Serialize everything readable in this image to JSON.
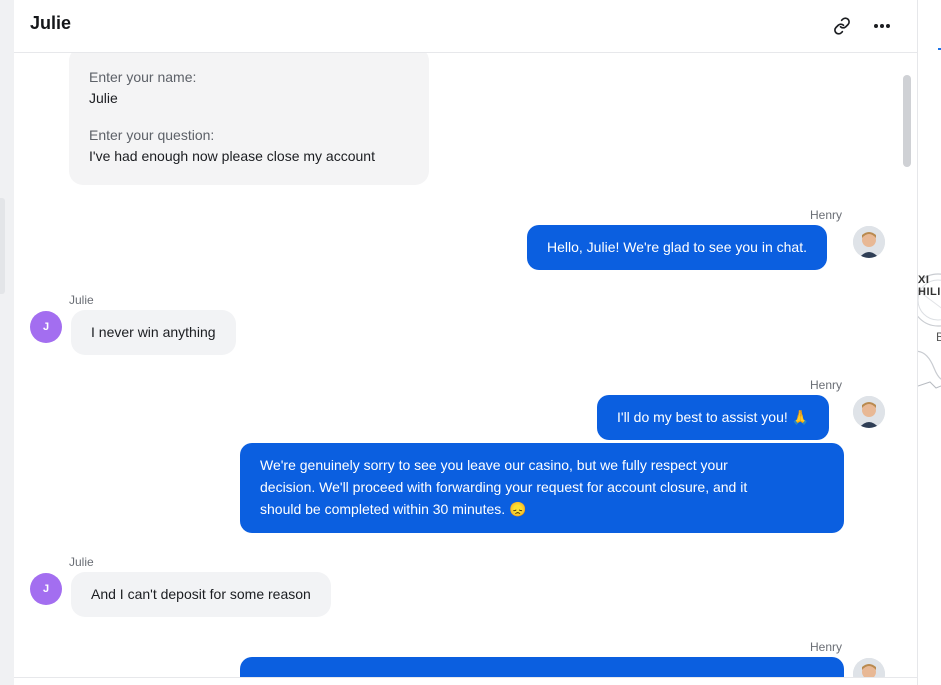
{
  "header": {
    "title": "Julie",
    "link_icon": "link-icon",
    "more_icon": "more-horizontal-icon"
  },
  "form": {
    "name_label": "Enter your name:",
    "name_value": "Julie",
    "question_label": "Enter your question:",
    "question_value": "I've had enough now please close my account"
  },
  "messages": [
    {
      "sender": "Henry",
      "text": "Hello, Julie! We're glad to see you in chat."
    },
    {
      "sender": "Julie",
      "avatar_letter": "J",
      "text": "I never win anything"
    },
    {
      "sender": "Henry",
      "text": "I'll do my best to assist you! 🙏"
    },
    {
      "text_lines": [
        "We're genuinely sorry to see you leave our casino, but we fully respect your",
        "decision. We'll proceed with forwarding your request for account closure, and it",
        "should be completed within 30 minutes. 😞"
      ]
    },
    {
      "sender": "Julie",
      "avatar_letter": "J",
      "text": "And I can't deposit for some reason"
    },
    {
      "sender": "Henry"
    }
  ],
  "side_map": {
    "label_1": "XI",
    "label_2": "HILI",
    "label_3": "B"
  },
  "colors": {
    "accent": "#0b5fe0",
    "avatar_julie": "#a36ef0"
  }
}
